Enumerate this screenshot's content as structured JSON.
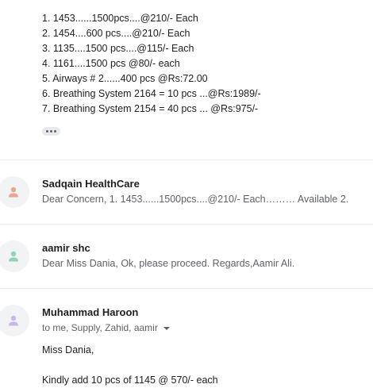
{
  "expanded_message": {
    "lines": [
      "1. 1453......1500pcs....@210/- Each",
      "2. 1454....600 pcs....@210/- Each",
      "3. 1135....1500 pcs....@115/- Each",
      "4. 1161....1500 pcs @80/- each",
      "5. Airways # 2......400 pcs  @Rs:72.00",
      "6. Breathing System 2164 = 10 pcs ...@Rs:1989/-",
      "7. Breathing System 2154 = 40 pcs ... @Rs:975/-"
    ],
    "show_trimmed_icon": "more-horiz-icon"
  },
  "collapsed_messages": [
    {
      "sender": "Sadqain HealthCare",
      "snippet": "Dear Concern, 1. 1453......1500pcs....@210/- Each……… Available 2.",
      "avatar_icon": "person-icon",
      "avatar_color": "#e8a598"
    },
    {
      "sender": "aamir shc",
      "snippet": "Dear Miss Dania, Ok, please proceed. Regards,Aamir Ali.",
      "avatar_icon": "person-icon",
      "avatar_color": "#8fd3b8"
    }
  ],
  "open_message": {
    "sender": "Muhammad Haroon",
    "recipients": "to me, Supply, Zahid, aamir",
    "recipients_icon": "caret-down-icon",
    "avatar_icon": "person-icon",
    "avatar_color": "#c8b6ef",
    "greeting": "Miss Dania,",
    "body": "Kindly add 10 pcs of 1145 @ 570/- each"
  }
}
